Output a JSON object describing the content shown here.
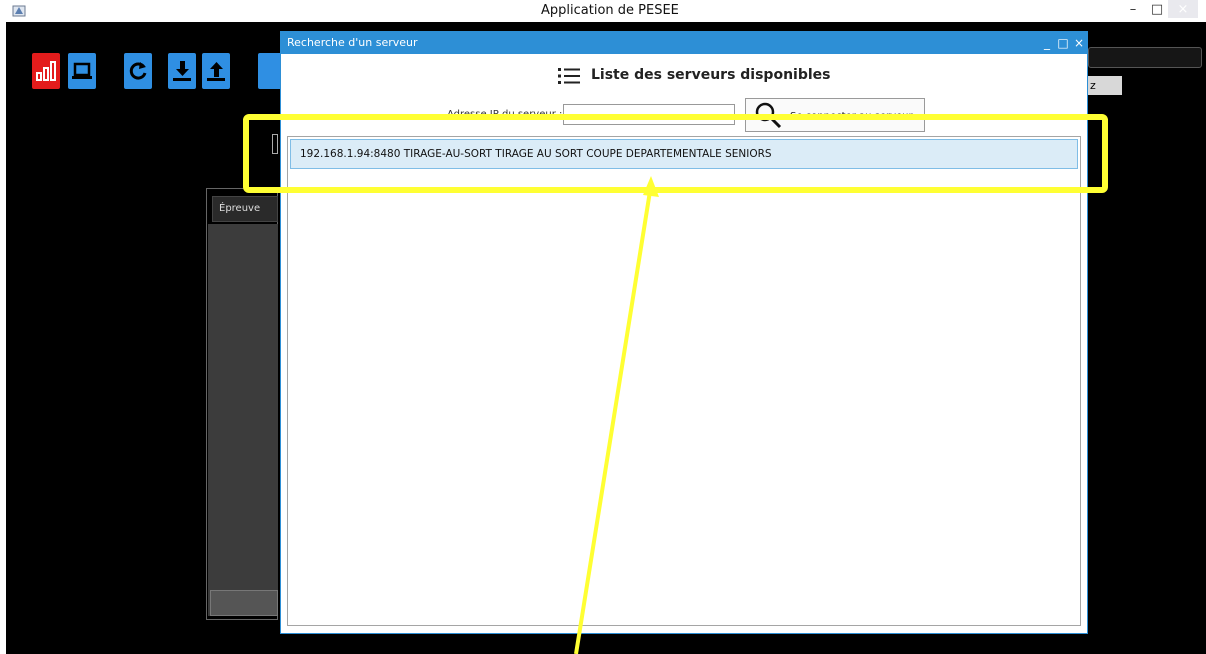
{
  "main_window": {
    "title": "Application de PESEE",
    "controls": {
      "minimize": "–",
      "maximize": "□",
      "close": "×"
    }
  },
  "toolbar": {
    "buttons": [
      {
        "icon": "bar-chart-icon",
        "color": "#e31c1c"
      },
      {
        "icon": "laptop-icon",
        "color": "#2f8fe3"
      },
      {
        "icon": "refresh-icon",
        "color": "#2f8fe3"
      },
      {
        "icon": "download-icon",
        "color": "#2f8fe3"
      },
      {
        "icon": "upload-icon",
        "color": "#2f8fe3"
      }
    ]
  },
  "background": {
    "right_button_label": "z",
    "panel_header": "Épreuve"
  },
  "dialog": {
    "title": "Recherche d'un serveur",
    "controls": {
      "minimize": "_",
      "maximize": "□",
      "close": "×"
    },
    "heading": "Liste des serveurs disponibles",
    "address_label": "Adresse IP du serveur :",
    "address_value": "",
    "connect_button": "Se connecter au serveur",
    "servers": [
      {
        "text": "192.168.1.94:8480   TIRAGE-AU-SORT   TIRAGE AU SORT   COUPE DEPARTEMENTALE SENIORS"
      }
    ]
  },
  "annotation": {
    "color": "#ffff33"
  }
}
